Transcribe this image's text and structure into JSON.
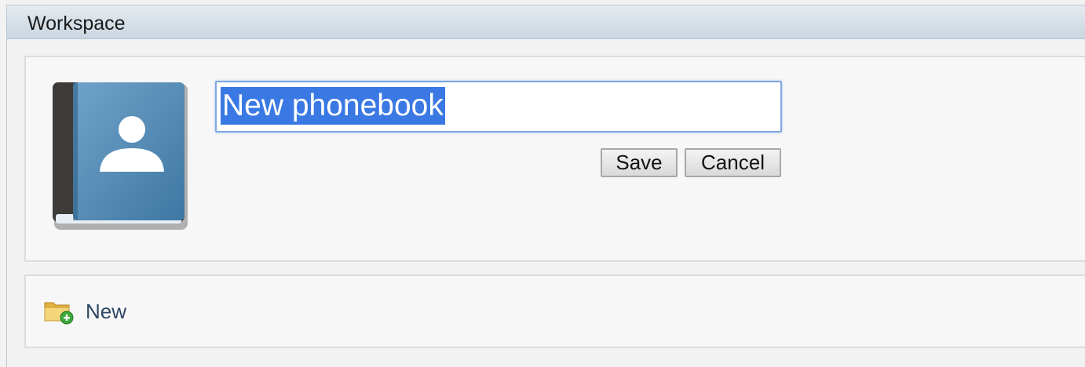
{
  "window": {
    "title": "Workspace"
  },
  "editor": {
    "name_value": "New phonebook",
    "save_label": "Save",
    "cancel_label": "Cancel"
  },
  "actions": {
    "new_label": "New"
  },
  "icons": {
    "phonebook": "phonebook-icon",
    "new_folder": "folder-add-icon"
  },
  "colors": {
    "selection": "#3a79e3",
    "book_cover": "#4a82ad",
    "book_spine": "#3d3a37",
    "action_text": "#2e4666"
  }
}
